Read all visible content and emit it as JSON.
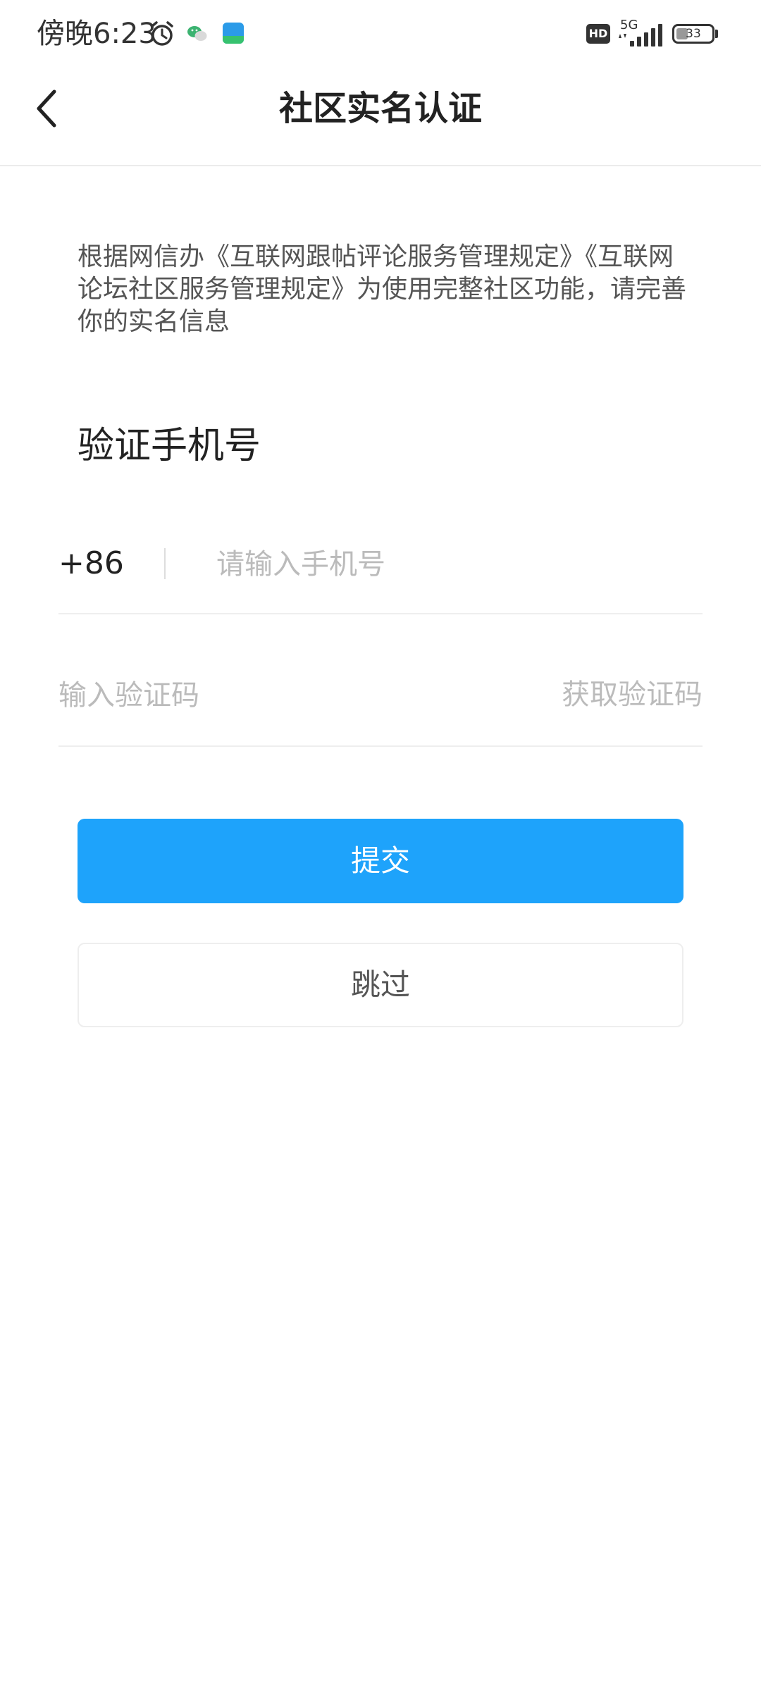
{
  "status_bar": {
    "time": "傍晚6:23",
    "network_badge": "HD",
    "network_type": "5G",
    "battery_level": "33",
    "icons": [
      "alarm-icon",
      "wechat-icon",
      "app-notification-icon",
      "hd-icon",
      "signal-icon",
      "battery-icon"
    ]
  },
  "header": {
    "back_icon": "chevron-left-icon",
    "title": "社区实名认证"
  },
  "notice": {
    "text": "根据网信办《互联网跟帖评论服务管理规定》《互联网论坛社区服务管理规定》为使用完整社区功能，请完善你的实名信息"
  },
  "form": {
    "heading": "验证手机号",
    "country_code": "+86",
    "phone_value": "",
    "phone_placeholder": "请输入手机号",
    "code_value": "",
    "code_placeholder": "输入验证码",
    "get_code_label": "获取验证码"
  },
  "actions": {
    "submit_label": "提交",
    "skip_label": "跳过"
  },
  "colors": {
    "primary": "#1ea3fb",
    "placeholder": "#bbbbbb",
    "divider": "#eeeeee",
    "title_text": "#222222",
    "body_text": "#555555"
  }
}
